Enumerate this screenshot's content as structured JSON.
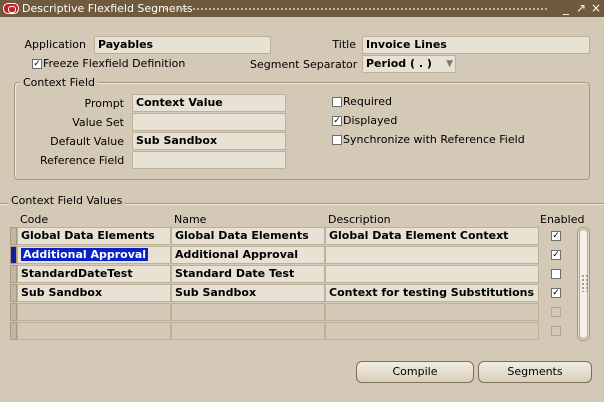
{
  "window": {
    "title": "Descriptive Flexfield Segments"
  },
  "header": {
    "application_label": "Application",
    "application_value": "Payables",
    "title_label": "Title",
    "title_value": "Invoice Lines",
    "freeze_label": "Freeze Flexfield Definition",
    "freeze_checked": "✓",
    "separator_label": "Segment Separator",
    "separator_value": "Period ( . )"
  },
  "context_field": {
    "group_title": "Context Field",
    "prompt_label": "Prompt",
    "prompt_value": "Context Value",
    "value_set_label": "Value Set",
    "value_set_value": "",
    "default_label": "Default Value",
    "default_value": "Sub Sandbox",
    "reference_label": "Reference Field",
    "reference_value": "",
    "required_label": "Required",
    "required_checked": "",
    "displayed_label": "Displayed",
    "displayed_checked": "✓",
    "sync_label": "Synchronize with Reference Field",
    "sync_checked": ""
  },
  "values": {
    "group_title": "Context Field Values",
    "columns": {
      "code": "Code",
      "name": "Name",
      "description": "Description",
      "enabled": "Enabled"
    },
    "rows": [
      {
        "code": "Global Data Elements",
        "name": "Global Data Elements",
        "description": "Global Data Element Context",
        "enabled": "✓"
      },
      {
        "code": "Additional Approval",
        "name": "Additional Approval",
        "description": "",
        "enabled": "✓"
      },
      {
        "code": "StandardDateTest",
        "name": "Standard Date Test",
        "description": "",
        "enabled": ""
      },
      {
        "code": "Sub Sandbox",
        "name": "Sub Sandbox",
        "description": "Context for testing Substitutions",
        "enabled": "✓"
      },
      {
        "code": "",
        "name": "",
        "description": "",
        "enabled": ""
      },
      {
        "code": "",
        "name": "",
        "description": "",
        "enabled": ""
      }
    ]
  },
  "buttons": {
    "compile": "Compile",
    "segments": "Segments"
  },
  "colors": {
    "background": "#d4c9b7",
    "titlebar": "#705a3e",
    "field": "#e8e2d4",
    "selection": "#0a22c4"
  }
}
